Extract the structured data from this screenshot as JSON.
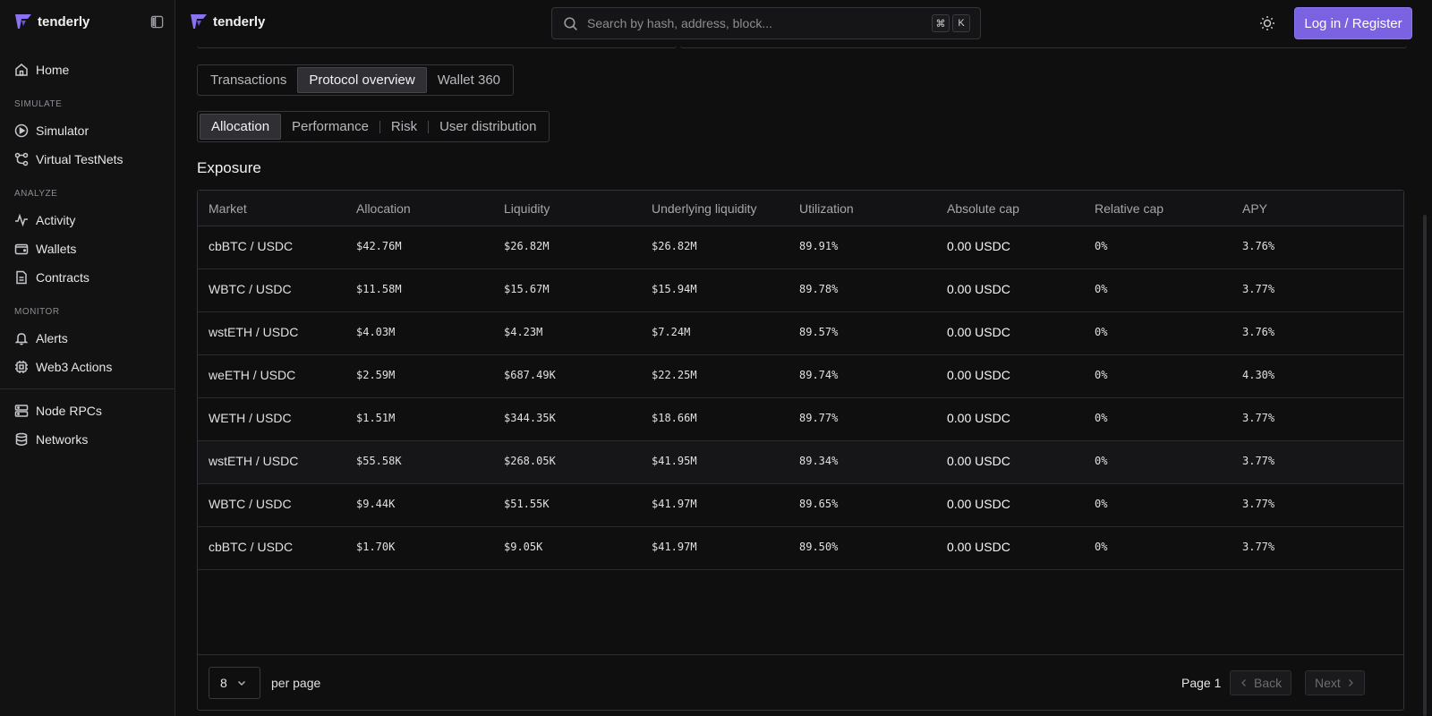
{
  "brand": {
    "name": "tenderly",
    "color": "#7a62e0"
  },
  "sidebar": {
    "items": [
      {
        "label": "Home",
        "icon": "home-icon"
      },
      {
        "label": "Simulator",
        "icon": "play-circle-icon"
      },
      {
        "label": "Virtual TestNets",
        "icon": "branch-icon"
      },
      {
        "label": "Activity",
        "icon": "activity-icon"
      },
      {
        "label": "Wallets",
        "icon": "wallet-icon"
      },
      {
        "label": "Contracts",
        "icon": "file-icon"
      },
      {
        "label": "Alerts",
        "icon": "bell-icon"
      },
      {
        "label": "Web3 Actions",
        "icon": "chip-icon"
      },
      {
        "label": "Node RPCs",
        "icon": "server-icon"
      },
      {
        "label": "Networks",
        "icon": "database-icon"
      }
    ],
    "sections": {
      "simulate": "SIMULATE",
      "analyze": "ANALYZE",
      "monitor": "MONITOR"
    }
  },
  "topbar": {
    "search_placeholder": "Search by hash, address, block...",
    "shortcut_cmd": "⌘",
    "shortcut_key": "K",
    "login_label": "Log in / Register"
  },
  "tabs_primary": [
    "Transactions",
    "Protocol overview",
    "Wallet 360"
  ],
  "tabs_primary_active": "Protocol overview",
  "tabs_secondary": [
    "Allocation",
    "Performance",
    "Risk",
    "User distribution"
  ],
  "tabs_secondary_active": "Allocation",
  "section_title": "Exposure",
  "table": {
    "columns": [
      "Market",
      "Allocation",
      "Liquidity",
      "Underlying liquidity",
      "Utilization",
      "Absolute cap",
      "Relative cap",
      "APY"
    ],
    "rows": [
      [
        "cbBTC / USDC",
        "$42.76M",
        "$26.82M",
        "$26.82M",
        "89.91%",
        "0.00 USDC",
        "0%",
        "3.76%"
      ],
      [
        "WBTC / USDC",
        "$11.58M",
        "$15.67M",
        "$15.94M",
        "89.78%",
        "0.00 USDC",
        "0%",
        "3.77%"
      ],
      [
        "wstETH / USDC",
        "$4.03M",
        "$4.23M",
        "$7.24M",
        "89.57%",
        "0.00 USDC",
        "0%",
        "3.76%"
      ],
      [
        "weETH / USDC",
        "$2.59M",
        "$687.49K",
        "$22.25M",
        "89.74%",
        "0.00 USDC",
        "0%",
        "4.30%"
      ],
      [
        "WETH / USDC",
        "$1.51M",
        "$344.35K",
        "$18.66M",
        "89.77%",
        "0.00 USDC",
        "0%",
        "3.77%"
      ],
      [
        "wstETH / USDC",
        "$55.58K",
        "$268.05K",
        "$41.95M",
        "89.34%",
        "0.00 USDC",
        "0%",
        "3.77%"
      ],
      [
        "WBTC / USDC",
        "$9.44K",
        "$51.55K",
        "$41.97M",
        "89.65%",
        "0.00 USDC",
        "0%",
        "3.77%"
      ],
      [
        "cbBTC / USDC",
        "$1.70K",
        "$9.05K",
        "$41.97M",
        "89.50%",
        "0.00 USDC",
        "0%",
        "3.77%"
      ]
    ],
    "highlighted_row": 5
  },
  "pagination": {
    "per_page_value": "8",
    "per_page_label": "per page",
    "page_label": "Page 1",
    "back_label": "Back",
    "next_label": "Next"
  }
}
